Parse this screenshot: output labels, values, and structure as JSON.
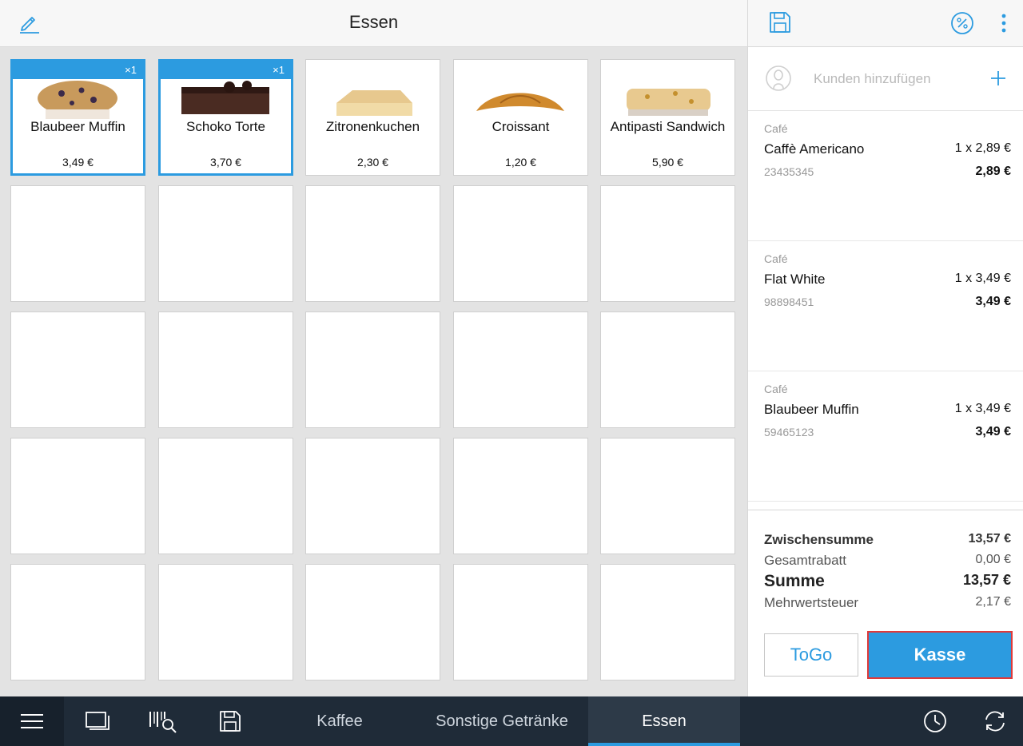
{
  "header": {
    "title": "Essen"
  },
  "products": [
    {
      "name": "Blaubeer Muffin",
      "price": "3,49 €",
      "badge": "×1",
      "selected": true,
      "image": "muffin"
    },
    {
      "name": "Schoko Torte",
      "price": "3,70 €",
      "badge": "×1",
      "selected": true,
      "image": "cake"
    },
    {
      "name": "Zitronenkuchen",
      "price": "2,30 €",
      "badge": "",
      "selected": false,
      "image": "lemon-cake"
    },
    {
      "name": "Croissant",
      "price": "1,20 €",
      "badge": "",
      "selected": false,
      "image": "croissant"
    },
    {
      "name": "Antipasti Sandwich",
      "price": "5,90 €",
      "badge": "",
      "selected": false,
      "image": "sandwich"
    }
  ],
  "customer": {
    "placeholder": "Kunden hinzufügen"
  },
  "cart": [
    {
      "category": "Café",
      "name": "Caffè Americano",
      "qty": "1 x 2,89 €",
      "sku": "23435345",
      "total": "2,89 €"
    },
    {
      "category": "Café",
      "name": "Flat White",
      "qty": "1 x 3,49 €",
      "sku": "98898451",
      "total": "3,49 €"
    },
    {
      "category": "Café",
      "name": "Blaubeer Muffin",
      "qty": "1 x 3,49 €",
      "sku": "59465123",
      "total": "3,49 €"
    }
  ],
  "summary": {
    "subtotal_label": "Zwischensumme",
    "subtotal": "13,57 €",
    "discount_label": "Gesamtrabatt",
    "discount": "0,00 €",
    "total_label": "Summe",
    "total": "13,57 €",
    "tax_label": "Mehrwertsteuer",
    "tax": "2,17 €"
  },
  "actions": {
    "togo_label": "ToGo",
    "checkout_label": "Kasse"
  },
  "bottom_tabs": [
    {
      "label": "Kaffee",
      "active": false
    },
    {
      "label": "Sonstige Getränke",
      "active": false
    },
    {
      "label": "Essen",
      "active": true
    }
  ],
  "colors": {
    "accent": "#2c9be0",
    "bar": "#1f2b38",
    "highlight": "#e03a3a"
  }
}
